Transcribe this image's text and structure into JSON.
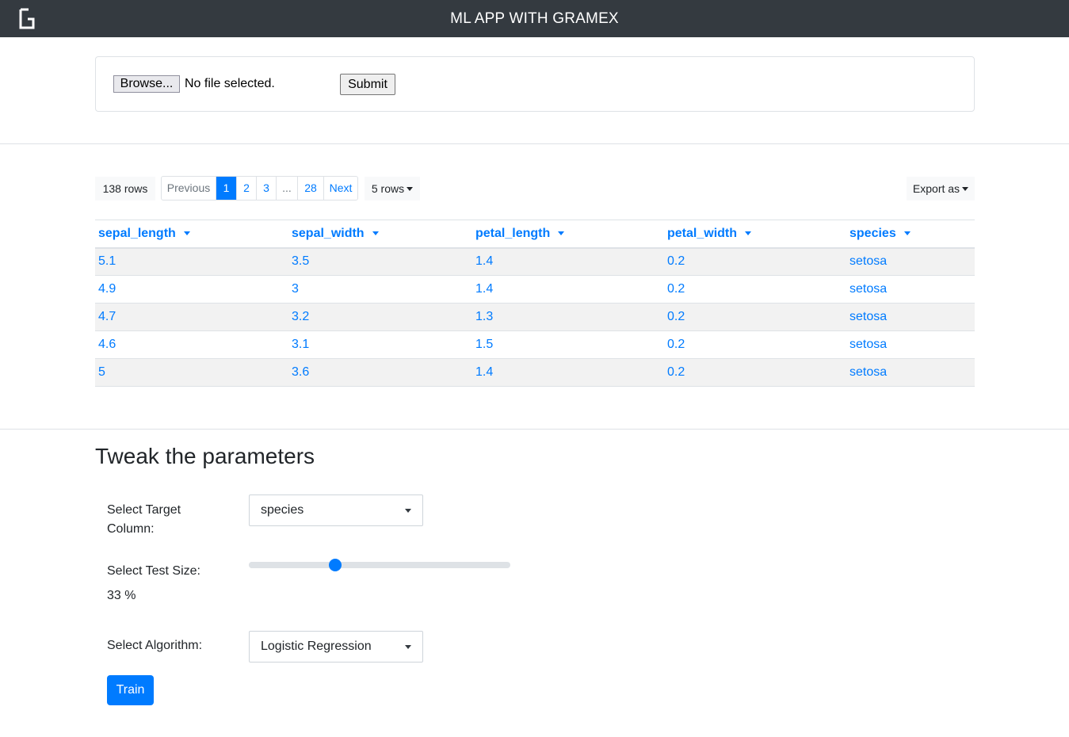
{
  "app": {
    "title": "ML APP WITH GRAMEX",
    "logo_icon": "gramex-logo-icon"
  },
  "upload": {
    "browse_label": "Browse...",
    "file_status": "No file selected.",
    "submit_label": "Submit"
  },
  "table": {
    "row_count": "138 rows",
    "pagination": [
      "Previous",
      "1",
      "2",
      "3",
      "...",
      "28",
      "Next"
    ],
    "active_page": "1",
    "page_size": "5 rows",
    "export_label": "Export as",
    "columns": [
      "sepal_length",
      "sepal_width",
      "petal_length",
      "petal_width",
      "species"
    ],
    "rows": [
      [
        "5.1",
        "3.5",
        "1.4",
        "0.2",
        "setosa"
      ],
      [
        "4.9",
        "3",
        "1.4",
        "0.2",
        "setosa"
      ],
      [
        "4.7",
        "3.2",
        "1.3",
        "0.2",
        "setosa"
      ],
      [
        "4.6",
        "3.1",
        "1.5",
        "0.2",
        "setosa"
      ],
      [
        "5",
        "3.6",
        "1.4",
        "0.2",
        "setosa"
      ]
    ]
  },
  "params": {
    "title": "Tweak the parameters",
    "target_label_line1": "Select Target",
    "target_label_line2": "Column:",
    "target_value": "species",
    "test_size_label": "Select Test Size:",
    "test_size_value": 33,
    "test_size_display": "33 %",
    "algorithm_label": "Select Algorithm:",
    "algorithm_value": "Logistic Regression",
    "train_label": "Train"
  },
  "colors": {
    "navbar": "#343a40",
    "accent": "#007bff",
    "stripe": "#f2f2f2"
  }
}
